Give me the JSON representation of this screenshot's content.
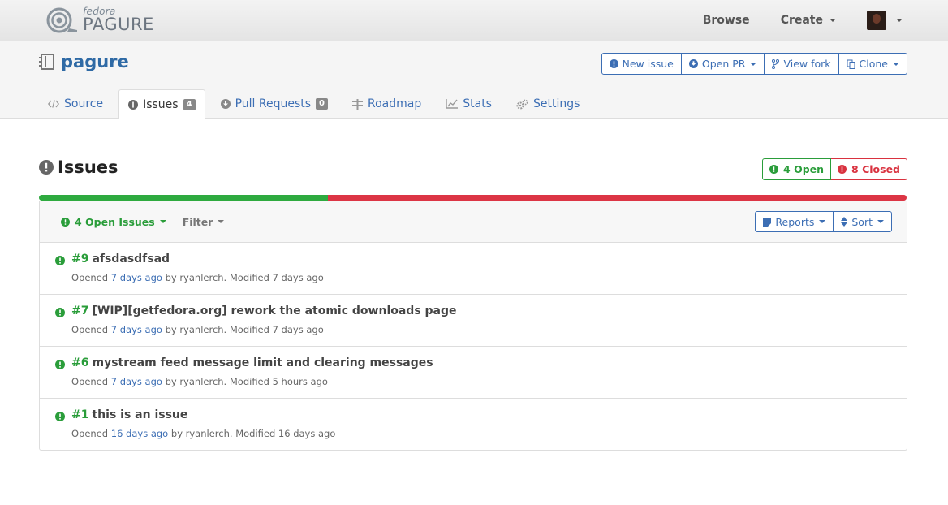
{
  "navbar": {
    "logo_small": "fedora",
    "logo_big": "PAGURE",
    "browse": "Browse",
    "create": "Create"
  },
  "repo": {
    "name": "pagure",
    "actions": [
      "New issue",
      "Open PR",
      "View fork",
      "Clone"
    ]
  },
  "tabs": [
    {
      "label": "Source",
      "icon": "code-icon"
    },
    {
      "label": "Issues",
      "count": "4",
      "icon": "exclamation-circle-icon"
    },
    {
      "label": "Pull Requests",
      "count": "0",
      "icon": "arrow-circle-down-icon"
    },
    {
      "label": "Roadmap",
      "icon": "roadmap-icon"
    },
    {
      "label": "Stats",
      "icon": "line-chart-icon"
    },
    {
      "label": "Settings",
      "icon": "gears-icon"
    }
  ],
  "issues": {
    "title": "Issues",
    "open_label": "4 Open",
    "closed_label": "8 Closed",
    "open_count": 4,
    "closed_count": 8,
    "filter_status": "4 Open Issues",
    "filter_label": "Filter",
    "reports_label": "Reports",
    "sort_label": "Sort",
    "colors": {
      "open": "#2a9d3a",
      "closed": "#d9323f",
      "link": "#3c6eb4"
    },
    "list": [
      {
        "num": "#9",
        "title": "afsdasdfsad",
        "opened": "Opened",
        "ago": "7 days ago",
        "rest": "by ryanlerch. Modified 7 days ago"
      },
      {
        "num": "#7",
        "title": "[WIP][getfedora.org] rework the atomic downloads page",
        "opened": "Opened",
        "ago": "7 days ago",
        "rest": "by ryanlerch. Modified 7 days ago"
      },
      {
        "num": "#6",
        "title": "mystream feed message limit and clearing messages",
        "opened": "Opened",
        "ago": "7 days ago",
        "rest": "by ryanlerch. Modified 5 hours ago"
      },
      {
        "num": "#1",
        "title": "this is an issue",
        "opened": "Opened",
        "ago": "16 days ago",
        "rest": "by ryanlerch. Modified 16 days ago"
      }
    ]
  }
}
